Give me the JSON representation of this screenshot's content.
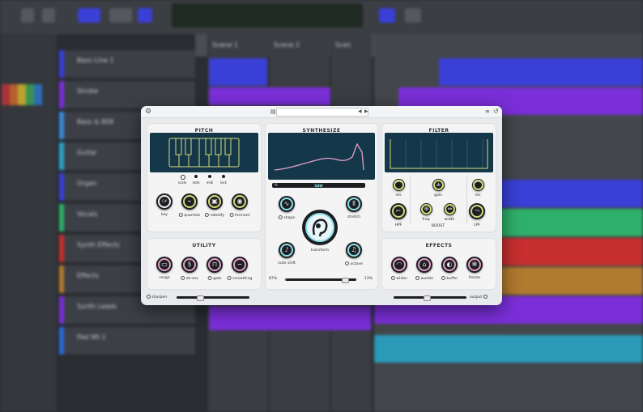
{
  "daw": {
    "tracks": [
      {
        "name": "Bass Line 1",
        "color": "#3a3fd8"
      },
      {
        "name": "Strobe",
        "color": "#7a2fd8"
      },
      {
        "name": "Bass & 808",
        "color": "#3a8bd8"
      },
      {
        "name": "Guitar",
        "color": "#2fa4c8"
      },
      {
        "name": "Organ",
        "color": "#3a3fd8"
      },
      {
        "name": "Vocals",
        "color": "#2fb06a"
      },
      {
        "name": "Synth Effects",
        "color": "#c82f2f"
      },
      {
        "name": "Effects",
        "color": "#b07a2f"
      },
      {
        "name": "Synth Leads",
        "color": "#7a2fd8"
      },
      {
        "name": "Pad Wt 2",
        "color": "#2a6ad8"
      }
    ],
    "scene_headers": [
      "Scene 1",
      "Scene 2",
      "Scen"
    ]
  },
  "plugin": {
    "pitch": {
      "title": "PITCH",
      "keyboard_labels": [
        "scale",
        "note",
        "midi",
        "lock"
      ],
      "knobs": [
        {
          "label": "key",
          "glyph": "C#"
        },
        {
          "label": "quantize"
        },
        {
          "label": "robotify"
        },
        {
          "label": "formant"
        }
      ]
    },
    "synthesize": {
      "title": "SYNTHESIZE",
      "wave_label": "SAW",
      "knobs": {
        "shape": "shape",
        "stretch": "stretch",
        "note_shift": "note shift",
        "octave": "octave",
        "transform": "transform"
      },
      "mix_left": "87%",
      "mix_right": "13%",
      "mix_value": 0.87
    },
    "filter": {
      "title": "FILTER",
      "labels": {
        "res_left": "res",
        "gain": "gain",
        "res_right": "res",
        "freq": "freq",
        "width": "width",
        "boost": "BOOST",
        "hpf": "HPF",
        "lpf": "LPF"
      }
    },
    "utility": {
      "title": "UTILITY",
      "knobs": [
        "range",
        "de-ess",
        "gate",
        "smoothing"
      ]
    },
    "effects": {
      "title": "EFFECTS",
      "knobs": [
        "widen",
        "warble",
        "buffer",
        "freeze"
      ]
    },
    "footer": {
      "sharpen": "sharpen",
      "output": "output",
      "sharpen_value": 0.3,
      "output_value": 0.45
    },
    "colors": {
      "accent_yellow": "#d6dc7a",
      "accent_pink": "#e4a1c9",
      "accent_cyan": "#8ae0e6",
      "screen": "#14384a"
    }
  }
}
